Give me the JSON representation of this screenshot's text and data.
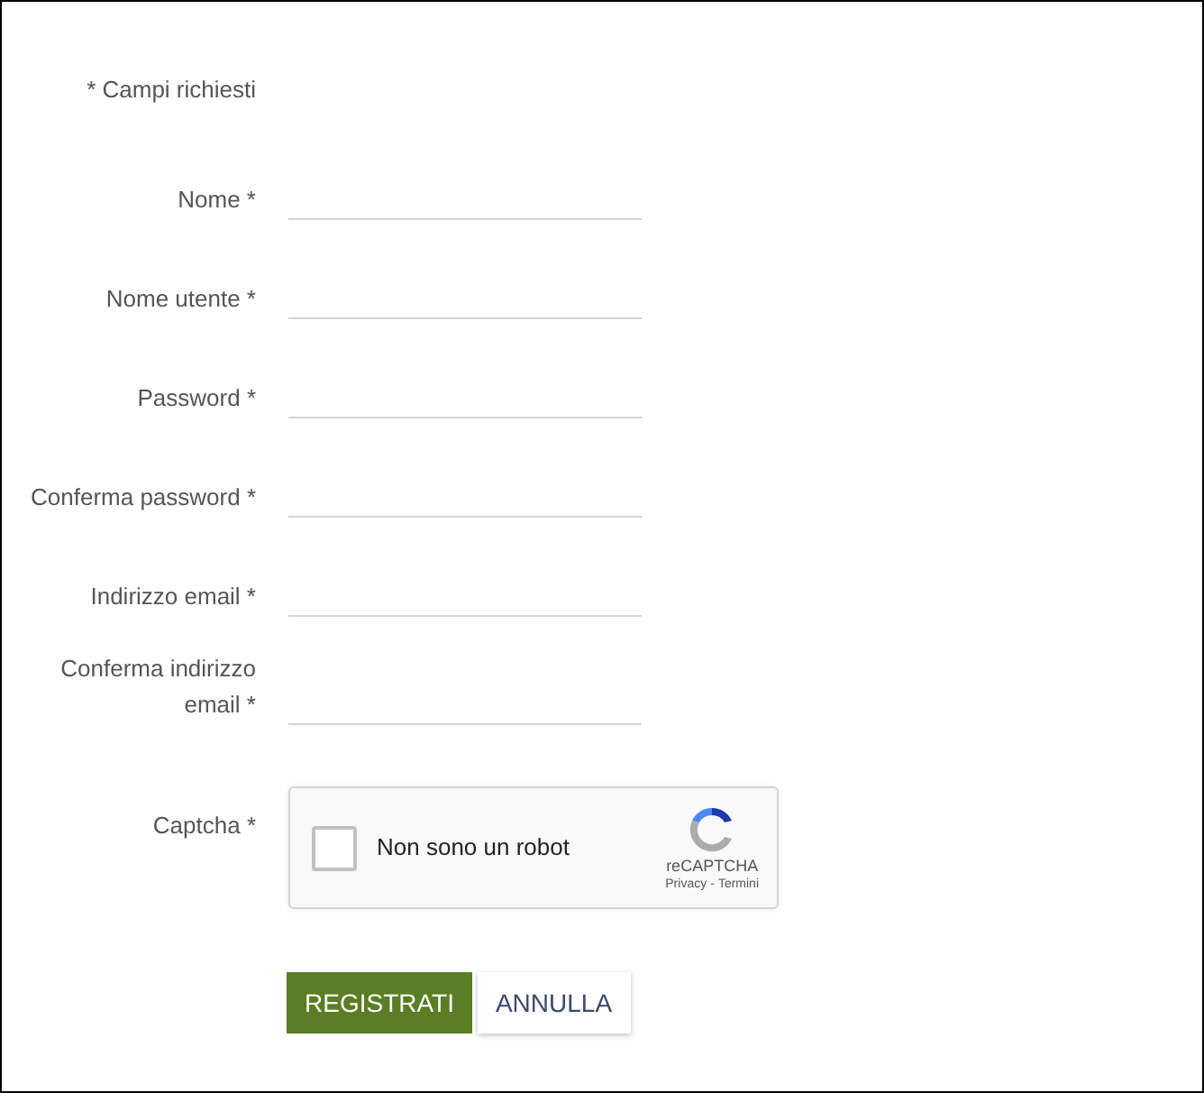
{
  "required_note": "* Campi richiesti",
  "fields": [
    {
      "label": "Nome *"
    },
    {
      "label": "Nome utente *"
    },
    {
      "label": "Password *"
    },
    {
      "label": "Conferma password *"
    },
    {
      "label": "Indirizzo email *"
    },
    {
      "label": "Conferma indirizzo email *"
    }
  ],
  "captcha": {
    "label": "Captcha *",
    "checkbox_label": "Non sono un robot",
    "checked": false,
    "brand": "reCAPTCHA",
    "links": [
      "Privacy",
      "Termini"
    ],
    "separator": "-"
  },
  "buttons": [
    {
      "label": "REGISTRATI",
      "kind": "primary"
    },
    {
      "label": "ANNULLA",
      "kind": "secondary"
    }
  ]
}
